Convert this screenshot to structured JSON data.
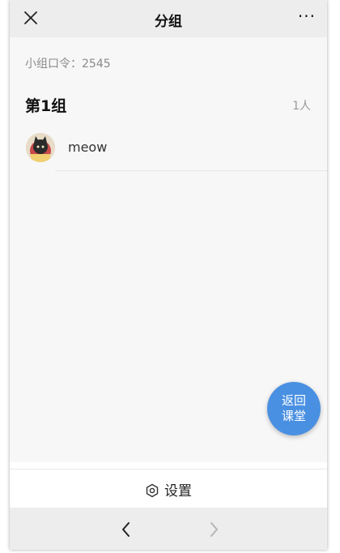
{
  "header": {
    "title": "分组",
    "close_icon": "close-icon",
    "more_label": "···"
  },
  "group": {
    "password_label": "小组口令：",
    "password_code": "2545",
    "name": "第1组",
    "count": "1人",
    "members": [
      {
        "name": "meow",
        "avatar": "cat-avatar"
      }
    ]
  },
  "fab": {
    "line1": "返回",
    "line2": "课堂",
    "color": "#4a90e2"
  },
  "settings": {
    "label": "设置",
    "icon": "gear-icon"
  },
  "nav": {
    "back_icon": "chevron-left-icon",
    "forward_icon": "chevron-right-icon"
  },
  "colors": {
    "bar_background": "#ededed",
    "content_background": "#f7f7f7",
    "accent": "#4a90e2"
  }
}
